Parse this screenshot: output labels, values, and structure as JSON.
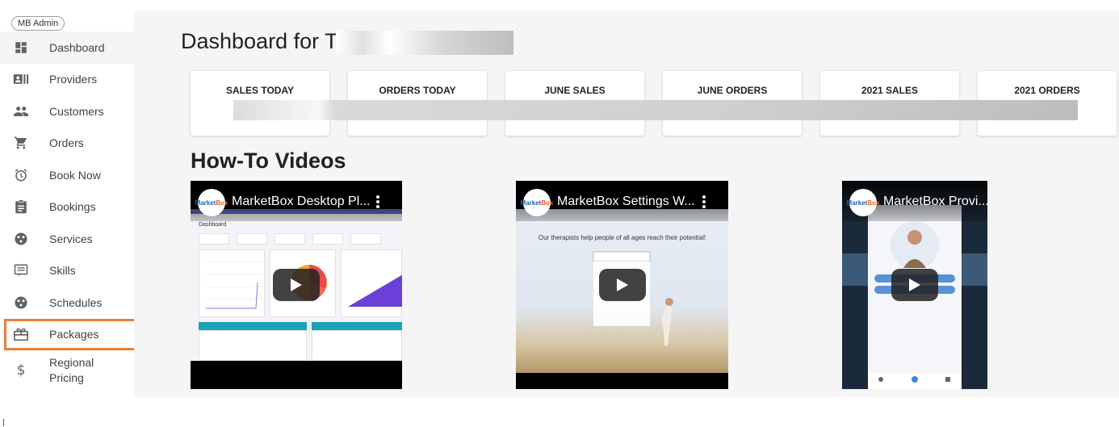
{
  "sidebar": {
    "role_chip": "MB Admin",
    "items": [
      {
        "label": "Dashboard",
        "icon": "dashboard-icon",
        "active": true
      },
      {
        "label": "Providers",
        "icon": "providers-icon"
      },
      {
        "label": "Customers",
        "icon": "customers-icon"
      },
      {
        "label": "Orders",
        "icon": "cart-icon"
      },
      {
        "label": "Book Now",
        "icon": "alarm-icon"
      },
      {
        "label": "Bookings",
        "icon": "clipboard-icon"
      },
      {
        "label": "Services",
        "icon": "services-icon"
      },
      {
        "label": "Skills",
        "icon": "skills-icon"
      },
      {
        "label": "Schedules",
        "icon": "schedules-icon"
      },
      {
        "label": "Packages",
        "icon": "packages-icon",
        "highlighted": true,
        "highlight_color": "#e8823a"
      },
      {
        "label": "Regional Pricing",
        "label_line1": "Regional",
        "label_line2": "Pricing",
        "icon": "dollar-icon"
      }
    ]
  },
  "main": {
    "title": "Dashboard for T",
    "stats": [
      {
        "label": "SALES TODAY"
      },
      {
        "label": "ORDERS TODAY"
      },
      {
        "label": "JUNE SALES"
      },
      {
        "label": "JUNE ORDERS"
      },
      {
        "label": "2021 SALES"
      },
      {
        "label": "2021 ORDERS"
      }
    ],
    "videos_title": "How-To Videos",
    "videos": [
      {
        "title": "MarketBox Desktop Pl...",
        "dashboard_label": "Dashboard"
      },
      {
        "title": "MarketBox Settings W...",
        "headline": "Our therapists help people of all ages reach their potential!"
      },
      {
        "title": "MarketBox Provi..."
      }
    ],
    "logo_text_a": "Market",
    "logo_text_b": "Box"
  },
  "colors": {
    "main_bg": "#f5f5f5",
    "accent_highlight": "#e8823a",
    "youtube_play": "#212121"
  }
}
